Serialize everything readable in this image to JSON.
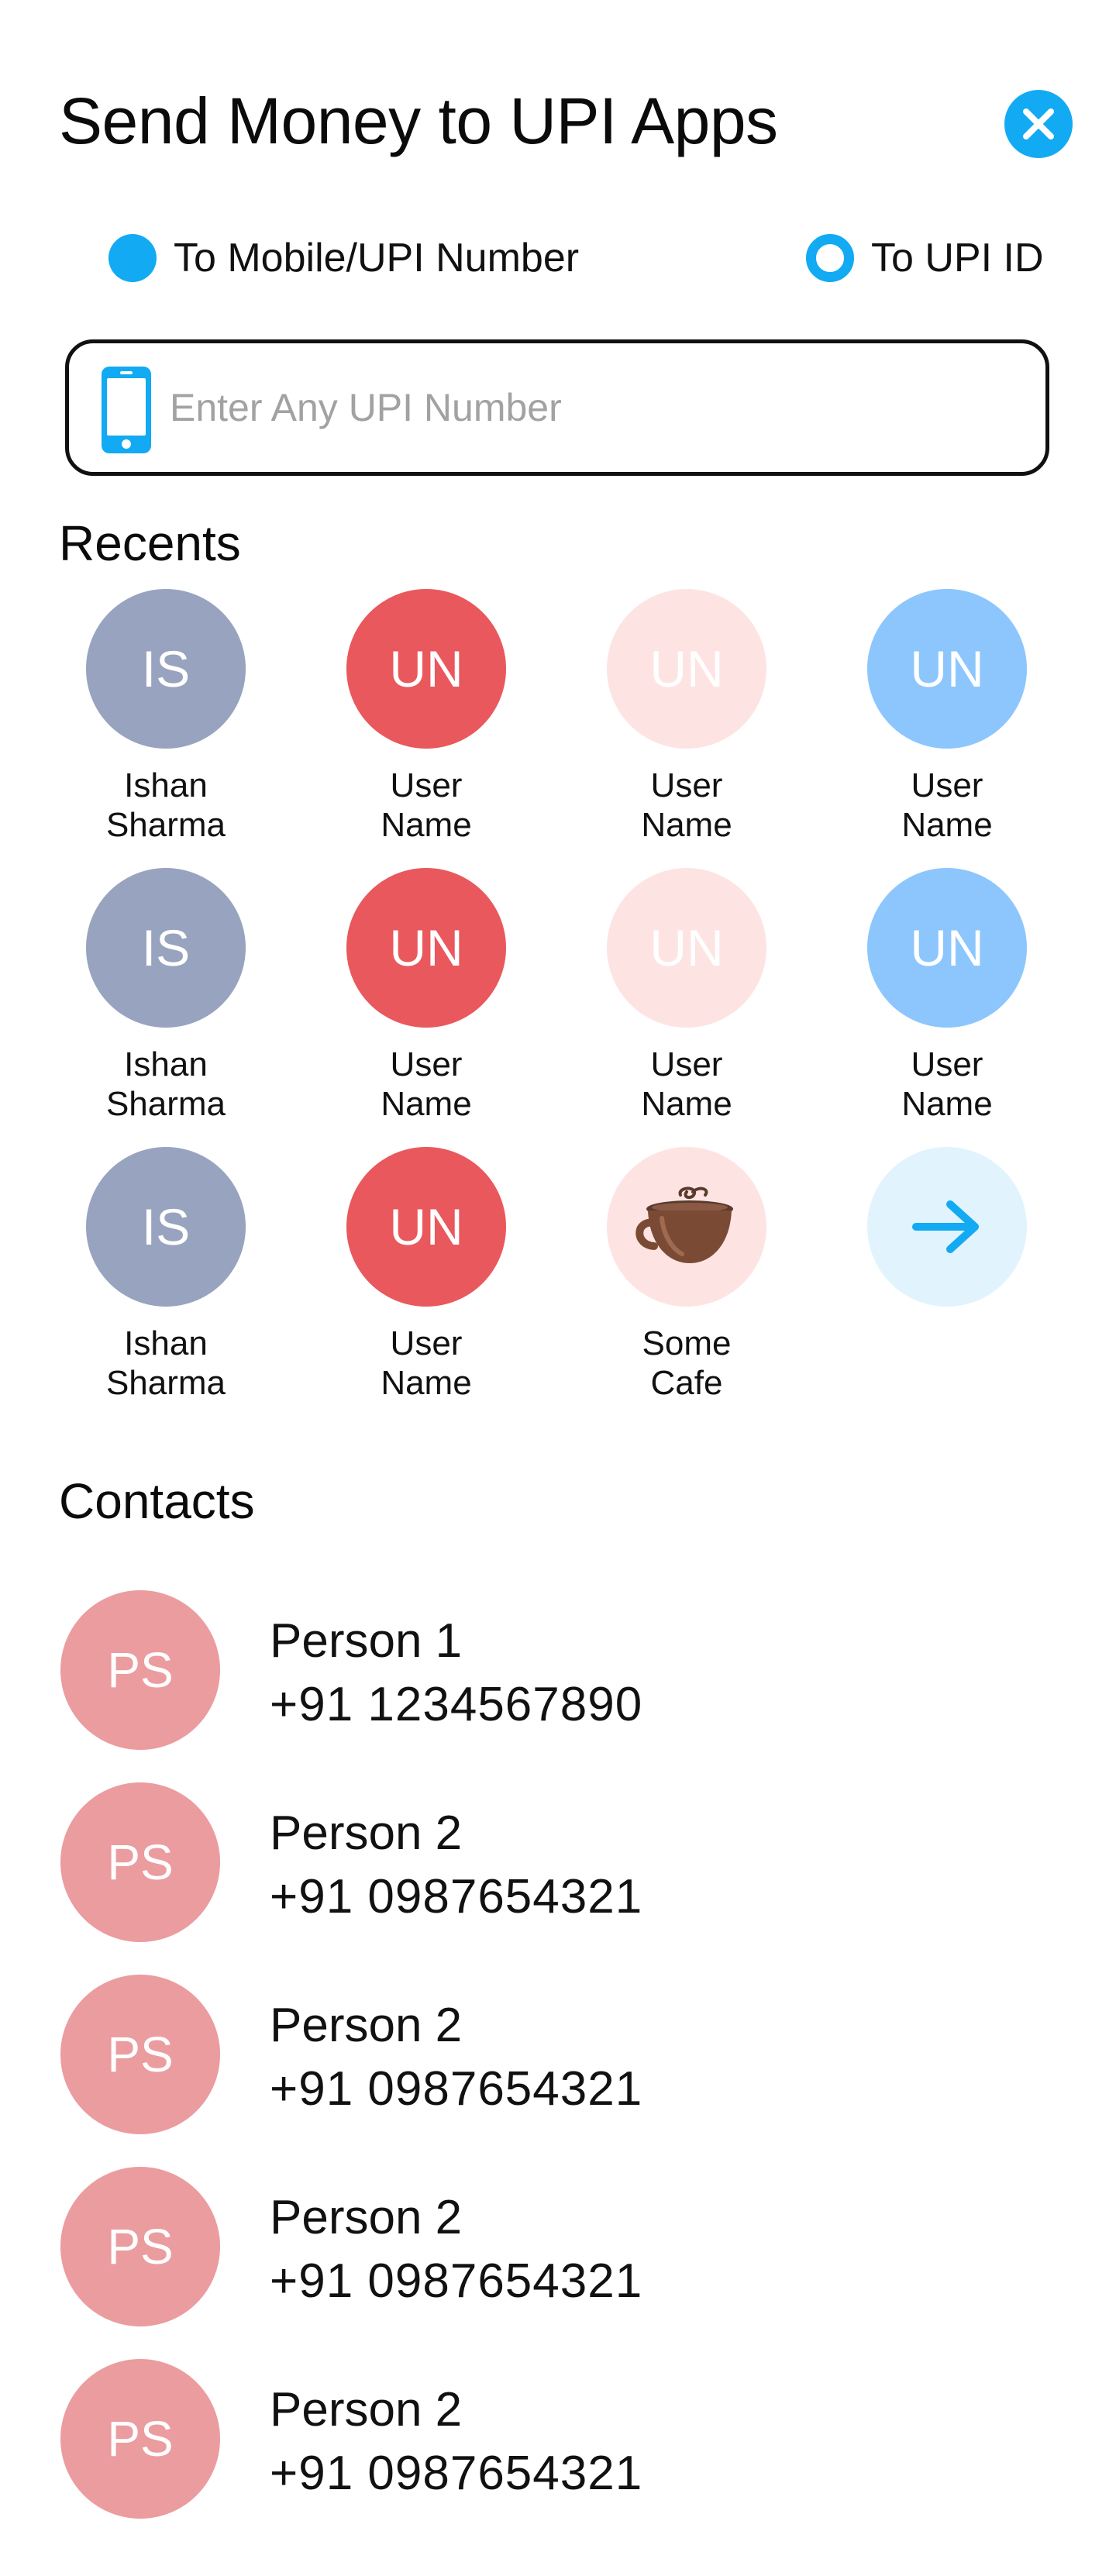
{
  "header": {
    "title": "Send Money to UPI Apps",
    "close_icon": "close-icon"
  },
  "colors": {
    "accent": "#12aaf3",
    "slate_avatar": "#98a3bf",
    "red_avatar": "#e9585c",
    "pink_light_avatar": "#fde4e3",
    "blue_avatar": "#8cc6fd",
    "cafe_avatar": "#fde4e3",
    "more_avatar": "#e1f3fd",
    "contact_avatar": "#eb9c9f"
  },
  "transfer_mode": {
    "options": [
      {
        "label": "To Mobile/UPI Number",
        "selected": true
      },
      {
        "label": "To UPI ID",
        "selected": false
      }
    ]
  },
  "search": {
    "icon": "mobile-phone-icon",
    "placeholder": "Enter Any UPI Number",
    "value": ""
  },
  "recents": {
    "title": "Recents",
    "items": [
      {
        "initials": "IS",
        "name_line1": "Ishan",
        "name_line2": "Sharma",
        "color": "#98a3bf"
      },
      {
        "initials": "UN",
        "name_line1": "User",
        "name_line2": "Name",
        "color": "#e9585c"
      },
      {
        "initials": "UN",
        "name_line1": "User",
        "name_line2": "Name",
        "color": "#fde4e3"
      },
      {
        "initials": "UN",
        "name_line1": "User",
        "name_line2": "Name",
        "color": "#8cc6fd"
      },
      {
        "initials": "IS",
        "name_line1": "Ishan",
        "name_line2": "Sharma",
        "color": "#98a3bf"
      },
      {
        "initials": "UN",
        "name_line1": "User",
        "name_line2": "Name",
        "color": "#e9585c"
      },
      {
        "initials": "UN",
        "name_line1": "User",
        "name_line2": "Name",
        "color": "#fde4e3"
      },
      {
        "initials": "UN",
        "name_line1": "User",
        "name_line2": "Name",
        "color": "#8cc6fd"
      },
      {
        "initials": "IS",
        "name_line1": "Ishan",
        "name_line2": "Sharma",
        "color": "#98a3bf"
      },
      {
        "initials": "UN",
        "name_line1": "User",
        "name_line2": "Name",
        "color": "#e9585c"
      },
      {
        "icon": "coffee-cup-icon",
        "name_line1": "Some",
        "name_line2": "Cafe",
        "color": "#fde4e3"
      },
      {
        "icon": "arrow-right-icon",
        "color": "#e1f3fd"
      }
    ]
  },
  "contacts": {
    "title": "Contacts",
    "items": [
      {
        "initials": "PS",
        "name": "Person 1",
        "phone": "+91 1234567890"
      },
      {
        "initials": "PS",
        "name": "Person 2",
        "phone": "+91 0987654321"
      },
      {
        "initials": "PS",
        "name": "Person 2",
        "phone": "+91 0987654321"
      },
      {
        "initials": "PS",
        "name": "Person 2",
        "phone": "+91 0987654321"
      },
      {
        "initials": "PS",
        "name": "Person 2",
        "phone": "+91 0987654321"
      }
    ]
  }
}
